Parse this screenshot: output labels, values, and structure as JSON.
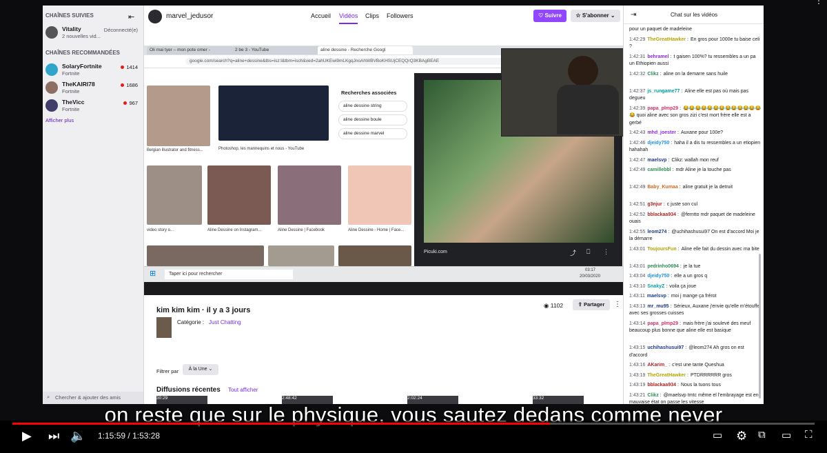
{
  "rail": {
    "followed_header": "CHAÎNES SUIVIES",
    "followed": [
      {
        "name": "Vitality",
        "sub": "2 nouvelles vid...",
        "status": "Déconnecté(e)"
      }
    ],
    "recommended_header": "CHAÎNES RECOMMANDÉES",
    "recommended": [
      {
        "name": "SolaryFortnite",
        "game": "Fortnite",
        "viewers": "1414"
      },
      {
        "name": "TheKAIRI78",
        "game": "Fortnite",
        "viewers": "1686"
      },
      {
        "name": "TheVicc",
        "game": "Fortnite",
        "viewers": "967"
      }
    ],
    "show_more": "Afficher plus",
    "search_friends": "Chercher & ajouter des amis"
  },
  "topbar": {
    "channel": "marvel_jedusor",
    "nav": [
      "Accueil",
      "Vidéos",
      "Clips",
      "Followers"
    ],
    "active_nav": "Vidéos",
    "follow": "Suivre",
    "subscribe": "S'abonner"
  },
  "browser": {
    "tabs": [
      "Oli mai tyer – mon pote omer -",
      "2 be 3 - YouTube",
      "aline dessine - Recherche Googl"
    ],
    "url": "google.com/search?q=aline+dessine&tbs=isz:l&tbm=isch&ved=2ahUKEwi9mLKgqJnoAhWBVBoKHSUjCEQQrQ3KBAgBEAE",
    "results": [
      "Belgian illustrator and fitness...",
      "Photoshop, les mannequins et nous - YouTube",
      "video story o...",
      "Aline Dessine on Instagram...",
      "Aline Dessine | Facebook",
      "Aline Dessine - Home | Face..."
    ],
    "related_title": "Recherches associées",
    "related": [
      "aline dessine string",
      "aline dessine boule",
      "aline dessine marvel"
    ],
    "preview_source": "Picuki.com",
    "taskbar_search": "Taper ici pour rechercher",
    "clock": "03:17",
    "date": "20/03/2020"
  },
  "video_info": {
    "title": "kim kim kim · il y a 3 jours",
    "category_label": "Catégorie :",
    "category": "Just Chatting",
    "views": "1102",
    "share": "Partager",
    "filter_label": "Filtrer par",
    "filter_value": "À la Une",
    "recent": "Diffusions récentes",
    "recent_all": "Tout afficher",
    "recent_durations": [
      "30:29",
      "2:48:42",
      "2:02:24",
      "33:32"
    ]
  },
  "chat": {
    "title": "Chat sur les vidéos",
    "messages": [
      {
        "t": "",
        "u": "",
        "c": "#18181b",
        "m": "pour un paquet de madeleine"
      },
      {
        "t": "1:42:29",
        "u": "TheGreatHawker",
        "c": "#b5a400",
        "m": "En gros pour 1000e tu baise celi ?"
      },
      {
        "t": "1:42:31",
        "u": "behramel",
        "c": "#8a2be2",
        "m": "t gaisen 100%? tu ressembles a un pa un Ethiopien aussi"
      },
      {
        "t": "1:42:32",
        "u": "Clikz",
        "c": "#2e8b57",
        "m": "aline on la demarre sans huile"
      },
      {
        "t": "1:42:37",
        "u": "js_rungame77",
        "c": "#00a0a0",
        "m": "Aline elle est pas où mais pas degueu"
      },
      {
        "t": "1:42:39",
        "u": "papa_plmp29",
        "c": "#d02f6a",
        "m": "😂😂😂😂😂😂😂😂😂😂😂😂😂😂 quoi aline avec son gros zizi c'est mort frère elle est a gerbé"
      },
      {
        "t": "1:42:43",
        "u": "mhd_joester",
        "c": "#8a2be2",
        "m": "Auxane pour 100e?"
      },
      {
        "t": "1:42:46",
        "u": "djeidy750",
        "c": "#1e90ff",
        "m": "haha il a dis tu ressembles a un etiopien hahahah"
      },
      {
        "t": "1:42:47",
        "u": "maelsvp",
        "c": "#1e3a8a",
        "m": "Clikz: wallah mon reuf"
      },
      {
        "t": "1:42:49",
        "u": "camillebbl",
        "c": "#2e8b57",
        "m": "mdr Aline je la touche pas"
      },
      {
        "t": "1:42:49",
        "u": "Baby_Kumaa",
        "c": "#d2691e",
        "m": "aline gratuit je la detruit"
      },
      {
        "t": "1:42:51",
        "u": "g3njur",
        "c": "#b22222",
        "m": "c juste son cul"
      },
      {
        "t": "1:42:52",
        "u": "bblackaa934",
        "c": "#b22222",
        "m": "@femtto mdr paquet de madeleine ouais"
      },
      {
        "t": "1:42:55",
        "u": "leom274",
        "c": "#1e3a8a",
        "m": "@uchihashusui97 On est d'accord Moi je la démarre"
      },
      {
        "t": "1:43:01",
        "u": "ToujoursFun",
        "c": "#b5a400",
        "m": "Aline elle fait du dessin avec ma bite"
      },
      {
        "t": "1:43:01",
        "u": "pedrinho0694",
        "c": "#2e8b57",
        "m": "je la tue"
      },
      {
        "t": "1:43:04",
        "u": "djeidy750",
        "c": "#1e90ff",
        "m": "elle a un gros q"
      },
      {
        "t": "1:43:10",
        "u": "SnakyZ",
        "c": "#00a0a0",
        "m": "voila ça joue"
      },
      {
        "t": "1:43:11",
        "u": "maelsvp",
        "c": "#1e3a8a",
        "m": "moi j mange ça frérot"
      },
      {
        "t": "1:43:13",
        "u": "mr_mu95",
        "c": "#1e3a8a",
        "m": "Sérieux, Auxane j'envie qu'elle m'étouffe avec ses grosses cuisses"
      },
      {
        "t": "1:43:14",
        "u": "papa_plmp29",
        "c": "#d02f6a",
        "m": "mais frère j'ai soulevé des meuf beaucoup plus bonne que aline elle est basique"
      },
      {
        "t": "1:43:15",
        "u": "uchihashusui97",
        "c": "#1e3a8a",
        "m": "@leom274 Ah gros on est d'accord"
      },
      {
        "t": "1:43:16",
        "u": "AKarim_",
        "c": "#b22222",
        "m": "c'est une tante Queshua"
      },
      {
        "t": "1:43:19",
        "u": "TheGreatHawker",
        "c": "#b5a400",
        "m": "PTDRRRRRR gros"
      },
      {
        "t": "1:43:19",
        "u": "bblackaa934",
        "c": "#b22222",
        "m": "Nous la tuons tous"
      },
      {
        "t": "1:43:21",
        "u": "Clikz",
        "c": "#2e8b57",
        "m": "@maelsvp tmtc même el l'embrayage est en mauvaise état on passe les vitesse"
      }
    ]
  },
  "player": {
    "subtitle": "on reste que sur le physique, vous sautez dedans comme never",
    "current_time": "1:15:59",
    "duration": "1:53:28",
    "progress_percent": 67
  }
}
